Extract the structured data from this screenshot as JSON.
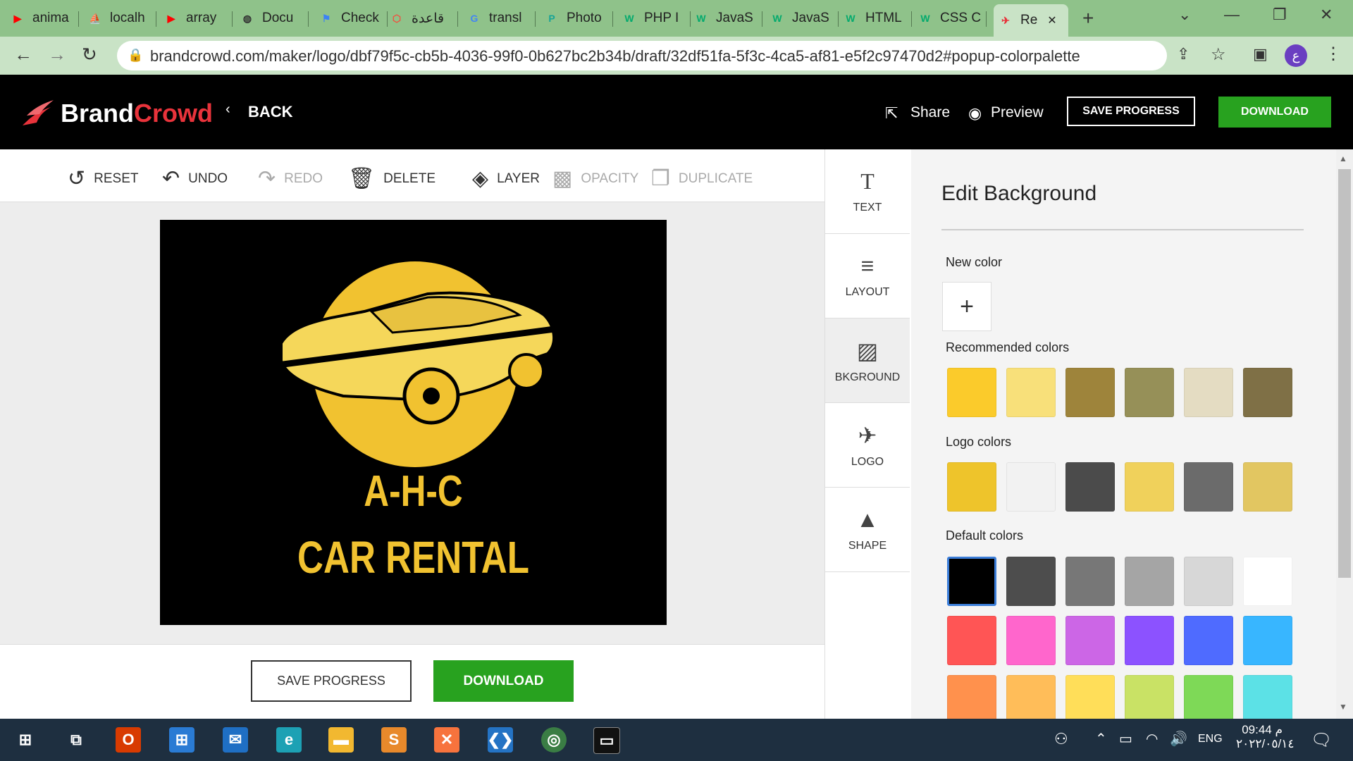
{
  "browser": {
    "tabs": [
      {
        "label": "anima",
        "fav": "youtube-icon"
      },
      {
        "label": "localh",
        "fav": "phpmyadmin-icon"
      },
      {
        "label": "array",
        "fav": "youtube-icon"
      },
      {
        "label": "Docu",
        "fav": "globe-icon"
      },
      {
        "label": "Check",
        "fav": "flag-icon"
      },
      {
        "label": "قاعدة",
        "fav": "laravel-icon"
      },
      {
        "label": "transl",
        "fav": "google-icon"
      },
      {
        "label": "Photo",
        "fav": "photopea-icon"
      },
      {
        "label": "PHP I",
        "fav": "w3schools-icon"
      },
      {
        "label": "JavaS",
        "fav": "w3schools-icon"
      },
      {
        "label": "JavaS",
        "fav": "w3schools-icon"
      },
      {
        "label": "HTML",
        "fav": "w3schools-icon"
      },
      {
        "label": "CSS C",
        "fav": "w3schools-icon"
      },
      {
        "label": "Re",
        "fav": "brandcrowd-icon"
      }
    ],
    "url": "brandcrowd.com/maker/logo/dbf79f5c-cb5b-4036-99f0-0b627bc2b34b/draft/32df51fa-5f3c-4ca5-af81-e5f2c97470d2#popup-colorpalette",
    "profile_initial": "ع"
  },
  "header": {
    "brand_part1": "Brand",
    "brand_part2": "Crowd",
    "back": "BACK",
    "share": "Share",
    "preview": "Preview",
    "save_progress": "SAVE PROGRESS",
    "download": "DOWNLOAD"
  },
  "toolbar": {
    "reset": "RESET",
    "undo": "UNDO",
    "redo": "REDO",
    "delete": "DELETE",
    "layer": "LAYER",
    "opacity": "OPACITY",
    "duplicate": "DUPLICATE"
  },
  "logo": {
    "line1": "A-H-C",
    "line2": "CAR RENTAL",
    "background": "#000000",
    "accent": "#f1c230"
  },
  "footer": {
    "save_progress": "SAVE PROGRESS",
    "download": "DOWNLOAD"
  },
  "sidenav": {
    "text": "TEXT",
    "layout": "LAYOUT",
    "background": "BKGROUND",
    "logo": "LOGO",
    "shape": "SHAPE"
  },
  "panel": {
    "title": "Edit Background",
    "new_color": "New color",
    "recommended": "Recommended colors",
    "logo_colors": "Logo colors",
    "default_colors": "Default colors",
    "recommended_swatches": [
      "#fbcb2b",
      "#f8e07a",
      "#9e843b",
      "#969058",
      "#e4dcc2",
      "#7f7046"
    ],
    "logo_swatches": [
      "#eec42b",
      "#f2f2f2",
      "#4b4b4b",
      "#f0d15b",
      "#6b6b6b",
      "#e2c661"
    ],
    "default_swatches_row1": [
      "#000000",
      "#4d4d4d",
      "#777777",
      "#a5a5a5",
      "#d7d7d7",
      "#ffffff"
    ],
    "default_swatches_row2": [
      "#ff5555",
      "#ff66cc",
      "#cc66e6",
      "#8c52ff",
      "#4f6bff",
      "#38b6ff"
    ],
    "default_swatches_row3": [
      "#ff914d",
      "#ffbd59",
      "#ffde59",
      "#c9e265",
      "#7ed957",
      "#5ce1e6"
    ]
  },
  "taskbar": {
    "time": "09:44 م",
    "date": "٢٠٢٢/٠٥/١٤",
    "lang": "ENG"
  }
}
